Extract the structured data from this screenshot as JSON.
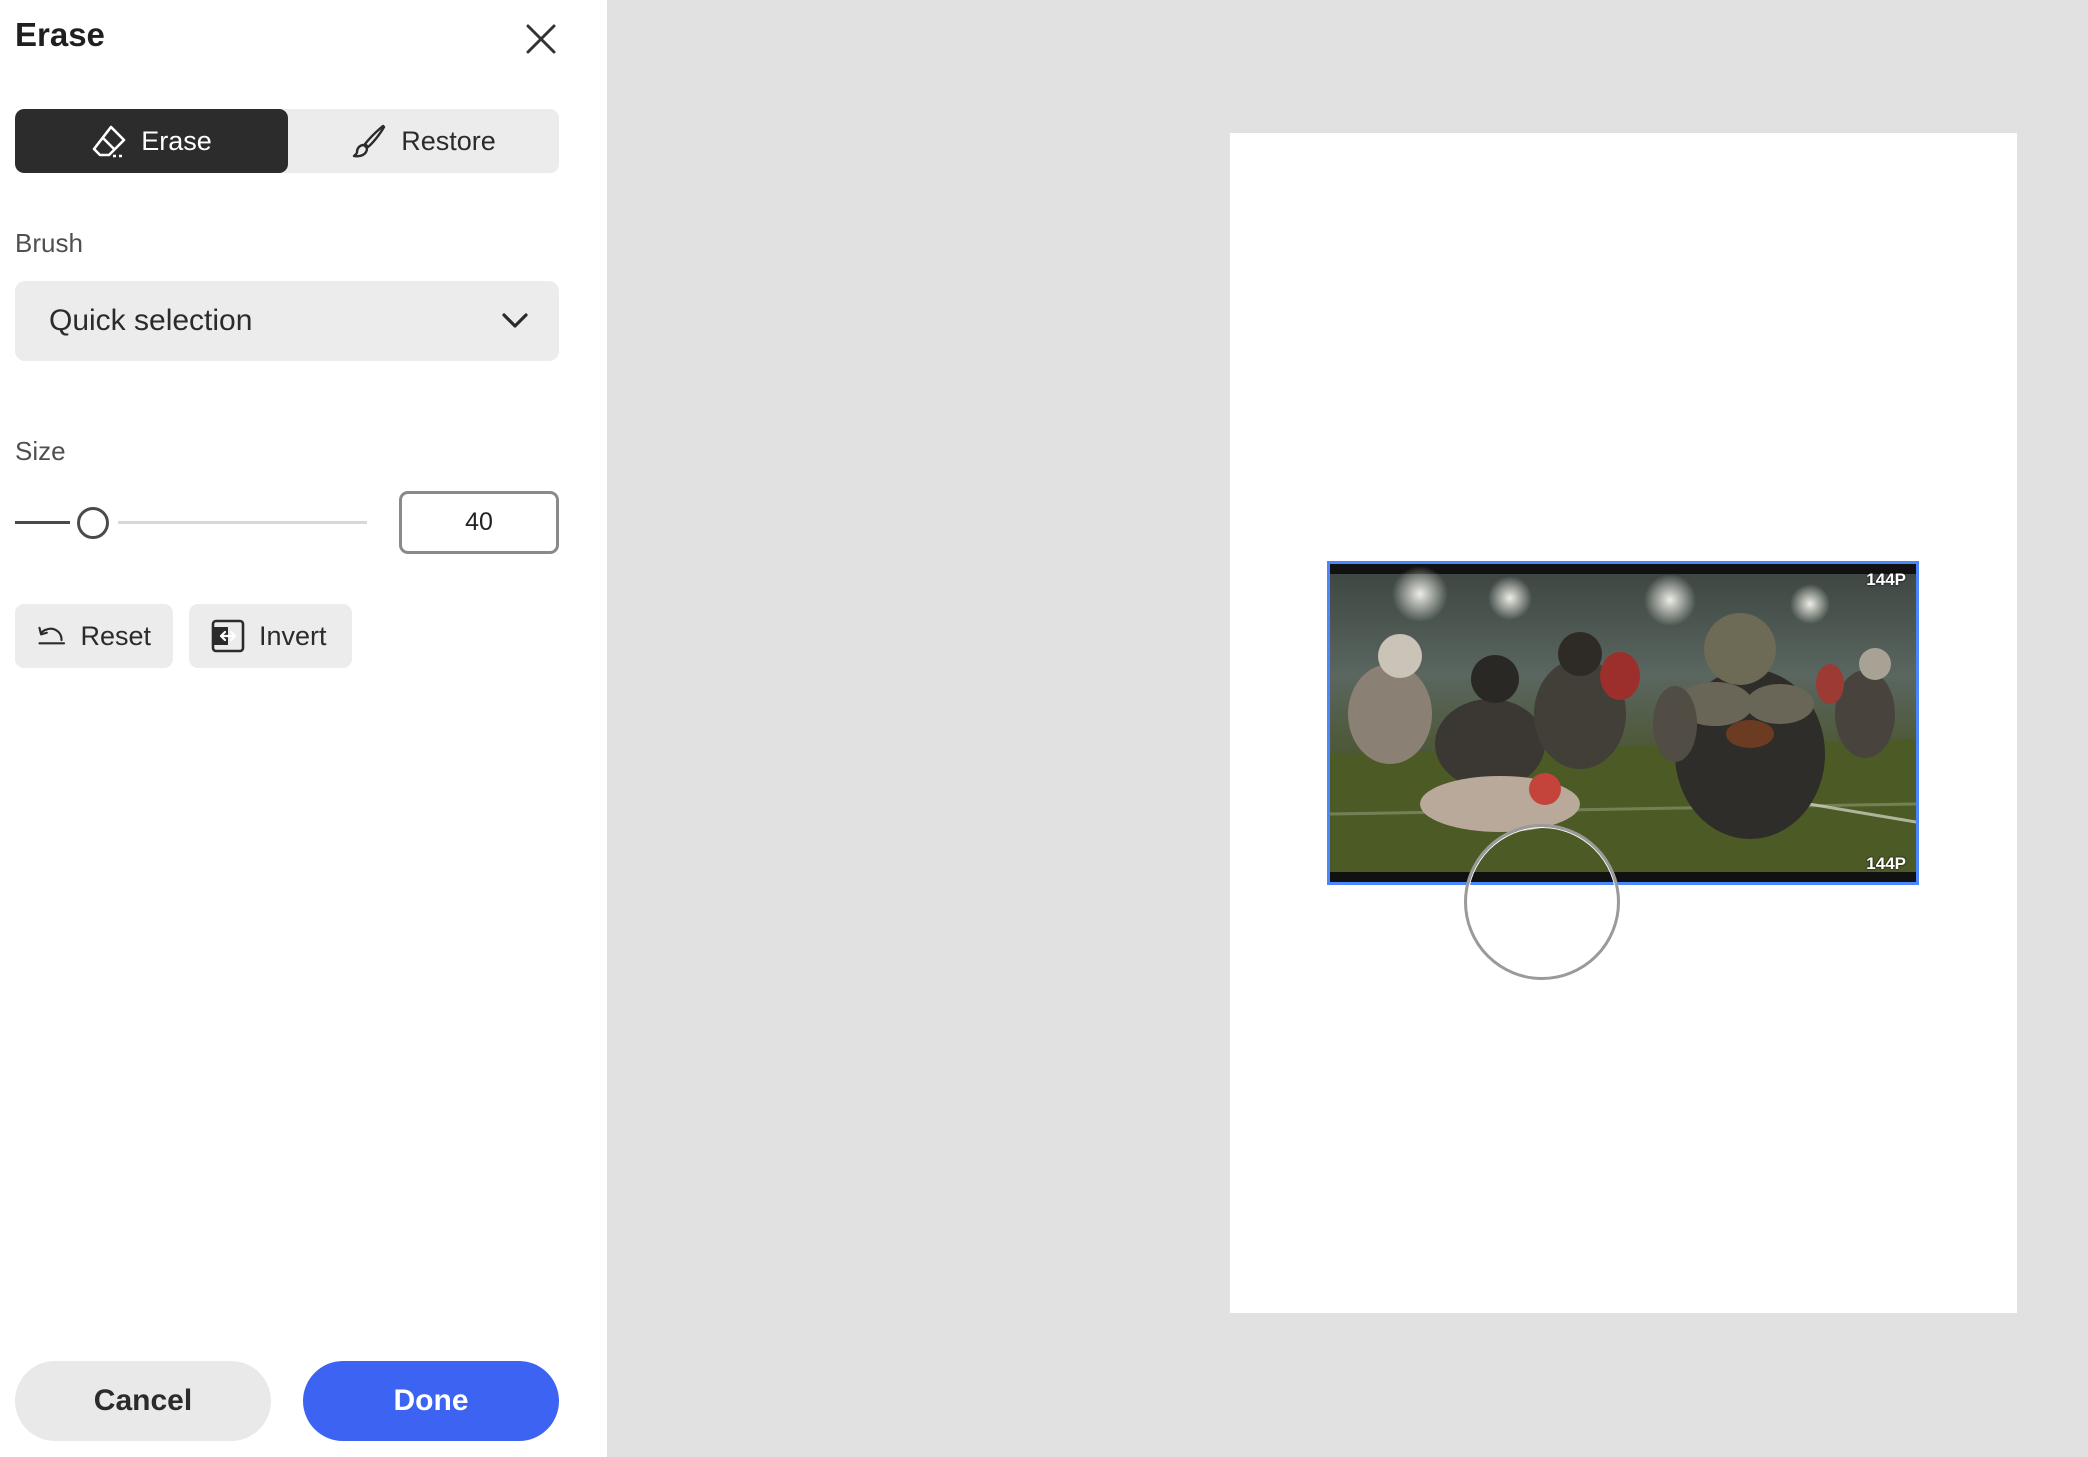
{
  "panel": {
    "title": "Erase",
    "close_icon": "close-icon"
  },
  "mode": {
    "erase_label": "Erase",
    "restore_label": "Restore",
    "selected": "Erase",
    "erase_icon": "eraser-icon",
    "restore_icon": "brush-icon"
  },
  "brush": {
    "label": "Brush",
    "selected": "Quick selection",
    "dropdown_icon": "chevron-down-icon"
  },
  "size": {
    "label": "Size",
    "value": "40",
    "slider_fraction": 0.2
  },
  "actions": {
    "reset_label": "Reset",
    "invert_label": "Invert",
    "reset_icon": "undo-icon",
    "invert_icon": "invert-icon"
  },
  "footer": {
    "cancel_label": "Cancel",
    "done_label": "Done"
  },
  "canvas": {
    "badge_top": "144P",
    "badge_bottom": "144P"
  },
  "colors": {
    "accent": "#3d63f3",
    "selection": "#4b86ff",
    "toggle_active": "#2c2c2c"
  }
}
